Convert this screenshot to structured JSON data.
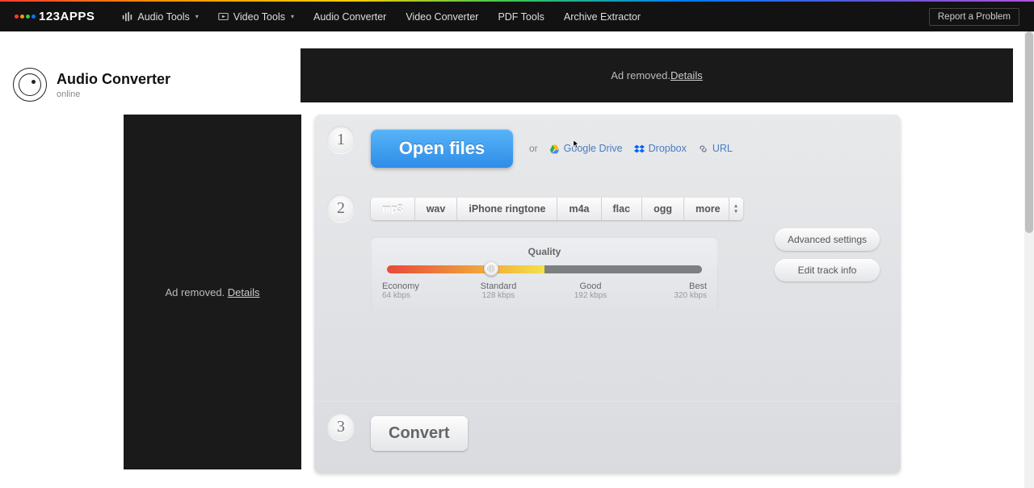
{
  "nav": {
    "brand": "123APPS",
    "items": [
      {
        "label": "Audio Tools",
        "dropdown": true,
        "icon": "audio"
      },
      {
        "label": "Video Tools",
        "dropdown": true,
        "icon": "video"
      },
      {
        "label": "Audio Converter",
        "dropdown": false
      },
      {
        "label": "Video Converter",
        "dropdown": false
      },
      {
        "label": "PDF Tools",
        "dropdown": false
      },
      {
        "label": "Archive Extractor",
        "dropdown": false
      }
    ],
    "report": "Report a Problem"
  },
  "page": {
    "title": "Audio Converter",
    "subtitle": "online"
  },
  "ads": {
    "removed_text": "Ad removed. ",
    "details": "Details"
  },
  "step1": {
    "num": "1",
    "open_label": "Open files",
    "or": "or",
    "sources": [
      {
        "label": "Google Drive",
        "icon": "gdrive"
      },
      {
        "label": "Dropbox",
        "icon": "dropbox"
      },
      {
        "label": "URL",
        "icon": "link"
      }
    ]
  },
  "step2": {
    "num": "2",
    "formats": [
      "mp3",
      "wav",
      "iPhone ringtone",
      "m4a",
      "flac",
      "ogg",
      "more"
    ],
    "quality_title": "Quality",
    "ticks": [
      {
        "name": "Economy",
        "kbps": "64 kbps"
      },
      {
        "name": "Standard",
        "kbps": "128 kbps"
      },
      {
        "name": "Good",
        "kbps": "192 kbps"
      },
      {
        "name": "Best",
        "kbps": "320 kbps"
      }
    ],
    "advanced": "Advanced settings",
    "edit_track": "Edit track info"
  },
  "step3": {
    "num": "3",
    "convert": "Convert"
  },
  "colors": {
    "logo_dots": [
      "#ff3b30",
      "#ff9500",
      "#34c759",
      "#007aff"
    ]
  }
}
